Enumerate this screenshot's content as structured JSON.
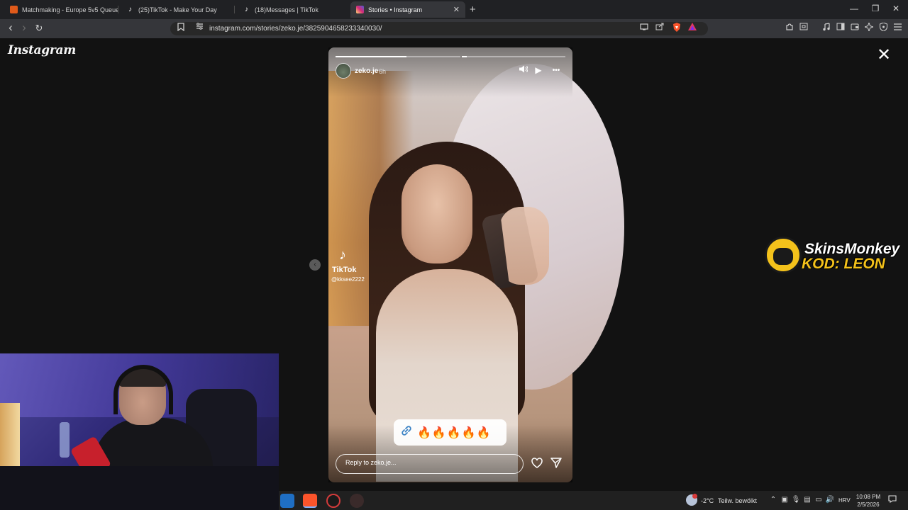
{
  "tabs": [
    {
      "title": "Matchmaking - Europe 5v5 Queue -",
      "active": false,
      "favicon_color": "#e05a1a"
    },
    {
      "title": "(25)TikTok - Make Your Day",
      "active": false,
      "favicon_color": "#ffffff"
    },
    {
      "title": "(18)Messages | TikTok",
      "active": false,
      "favicon_color": "#ffffff"
    },
    {
      "title": "Stories • Instagram",
      "active": true,
      "favicon_color": "#d62976"
    }
  ],
  "new_tab_label": "+",
  "window": {
    "minimize": "—",
    "restore": "❐",
    "close": "✕"
  },
  "nav": {
    "back": "‹",
    "forward": "›",
    "reload": "↻",
    "bookmark": "🔖",
    "site_info": "⚙"
  },
  "url": "instagram.com/stories/zeko.je/3825904658233340030/",
  "instagram_logo": "Instagram",
  "story": {
    "username": "zeko.je",
    "time": "6h",
    "progress": [
      0.57,
      0.05,
      0,
      0
    ],
    "tiktok_brand": "TikTok",
    "tiktok_handle": "@kksee2222",
    "sticker_text": "🔥🔥🔥🔥🔥",
    "reply_placeholder": "Reply to zeko.je..."
  },
  "icons": {
    "close": "✕",
    "prev": "‹",
    "mute": "🔈",
    "play": "▶",
    "more": "•••",
    "like": "♡",
    "share": "➤",
    "link": "🔗",
    "tiktok": "♪"
  },
  "overlay": {
    "line1": "SkinsMonkey",
    "line2": "KOD: LEON"
  },
  "taskbar": {
    "temperature": "-2°C",
    "weather": "Teilw. bewölkt",
    "language": "HRV",
    "time": "10:08 PM",
    "date": "2/5/2026"
  },
  "colors": {
    "instagram_accent": "#d62976",
    "brave_orange": "#fb542b",
    "skinsmonkey_yellow": "#f4c21b"
  }
}
